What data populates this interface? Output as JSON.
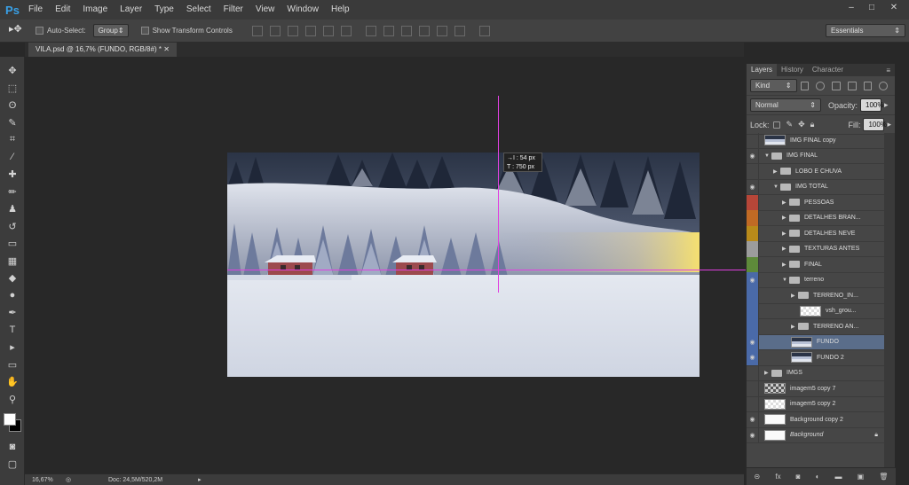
{
  "menubar": {
    "logo": "Ps",
    "items": [
      "File",
      "Edit",
      "Image",
      "Layer",
      "Type",
      "Select",
      "Filter",
      "View",
      "Window",
      "Help"
    ]
  },
  "options_bar": {
    "auto_select_label": "Auto-Select:",
    "auto_select_value": "Group",
    "show_transform_label": "Show Transform Controls",
    "workspace": "Essentials"
  },
  "document": {
    "tab_title": "VILA.psd @ 16,7% (FUNDO, RGB/8#) *"
  },
  "tooltip": {
    "line1": "→I : 54 px",
    "line2": "T : 750 px"
  },
  "status": {
    "zoom": "16,67%",
    "doc_size": "Doc: 24,5M/520,2M"
  },
  "panel": {
    "tabs": [
      "Layers",
      "History",
      "Character"
    ],
    "kind_label": "Kind",
    "blend_mode": "Normal",
    "opacity_label": "Opacity:",
    "opacity_value": "100%",
    "lock_label": "Lock:",
    "fill_label": "Fill:",
    "fill_value": "100%"
  },
  "layers": [
    {
      "name": "IMG FINAL copy",
      "indent": 0,
      "type": "image",
      "visible": false
    },
    {
      "name": "IMG FINAL",
      "indent": 0,
      "type": "folder",
      "visible": true,
      "open": true
    },
    {
      "name": "LOBO E CHUVA",
      "indent": 1,
      "type": "folder",
      "visible": false
    },
    {
      "name": "IMG TOTAL",
      "indent": 1,
      "type": "folder",
      "visible": true,
      "open": true
    },
    {
      "name": "PESSOAS",
      "indent": 2,
      "type": "folder",
      "visible": false,
      "color": "#b64638"
    },
    {
      "name": "DETALHES BRAN...",
      "indent": 2,
      "type": "folder",
      "visible": false,
      "color": "#c06a24"
    },
    {
      "name": "DETALHES NEVE",
      "indent": 2,
      "type": "folder",
      "visible": false,
      "color": "#b88a1a"
    },
    {
      "name": "TEXTURAS ANTES",
      "indent": 2,
      "type": "folder",
      "visible": false,
      "color": "#9c9c9c"
    },
    {
      "name": "FINAL",
      "indent": 2,
      "type": "folder",
      "visible": false,
      "color": "#5e8a3a"
    },
    {
      "name": "terreno",
      "indent": 2,
      "type": "folder",
      "visible": true,
      "color": "#4a6aa8",
      "open": true
    },
    {
      "name": "TERRENO_IN...",
      "indent": 3,
      "type": "folder",
      "visible": false,
      "color": "#4a6aa8"
    },
    {
      "name": "vsh_grou...",
      "indent": 4,
      "type": "checker",
      "visible": false,
      "color": "#4a6aa8"
    },
    {
      "name": "TERRENO AN...",
      "indent": 3,
      "type": "folder",
      "visible": false,
      "color": "#4a6aa8"
    },
    {
      "name": "FUNDO",
      "indent": 3,
      "type": "image",
      "visible": true,
      "color": "#4a6aa8",
      "selected": true
    },
    {
      "name": "FUNDO 2",
      "indent": 3,
      "type": "image",
      "visible": true,
      "color": "#4a6aa8"
    },
    {
      "name": "IMGS",
      "indent": 0,
      "type": "folder",
      "visible": false
    },
    {
      "name": "imagem5 copy 7",
      "indent": 0,
      "type": "dark",
      "visible": false
    },
    {
      "name": "imagem5 copy 2",
      "indent": 0,
      "type": "checker",
      "visible": false
    },
    {
      "name": "Background copy 2",
      "indent": 0,
      "type": "white",
      "visible": true
    },
    {
      "name": "Background",
      "indent": 0,
      "type": "white",
      "visible": true,
      "locked": true
    }
  ]
}
